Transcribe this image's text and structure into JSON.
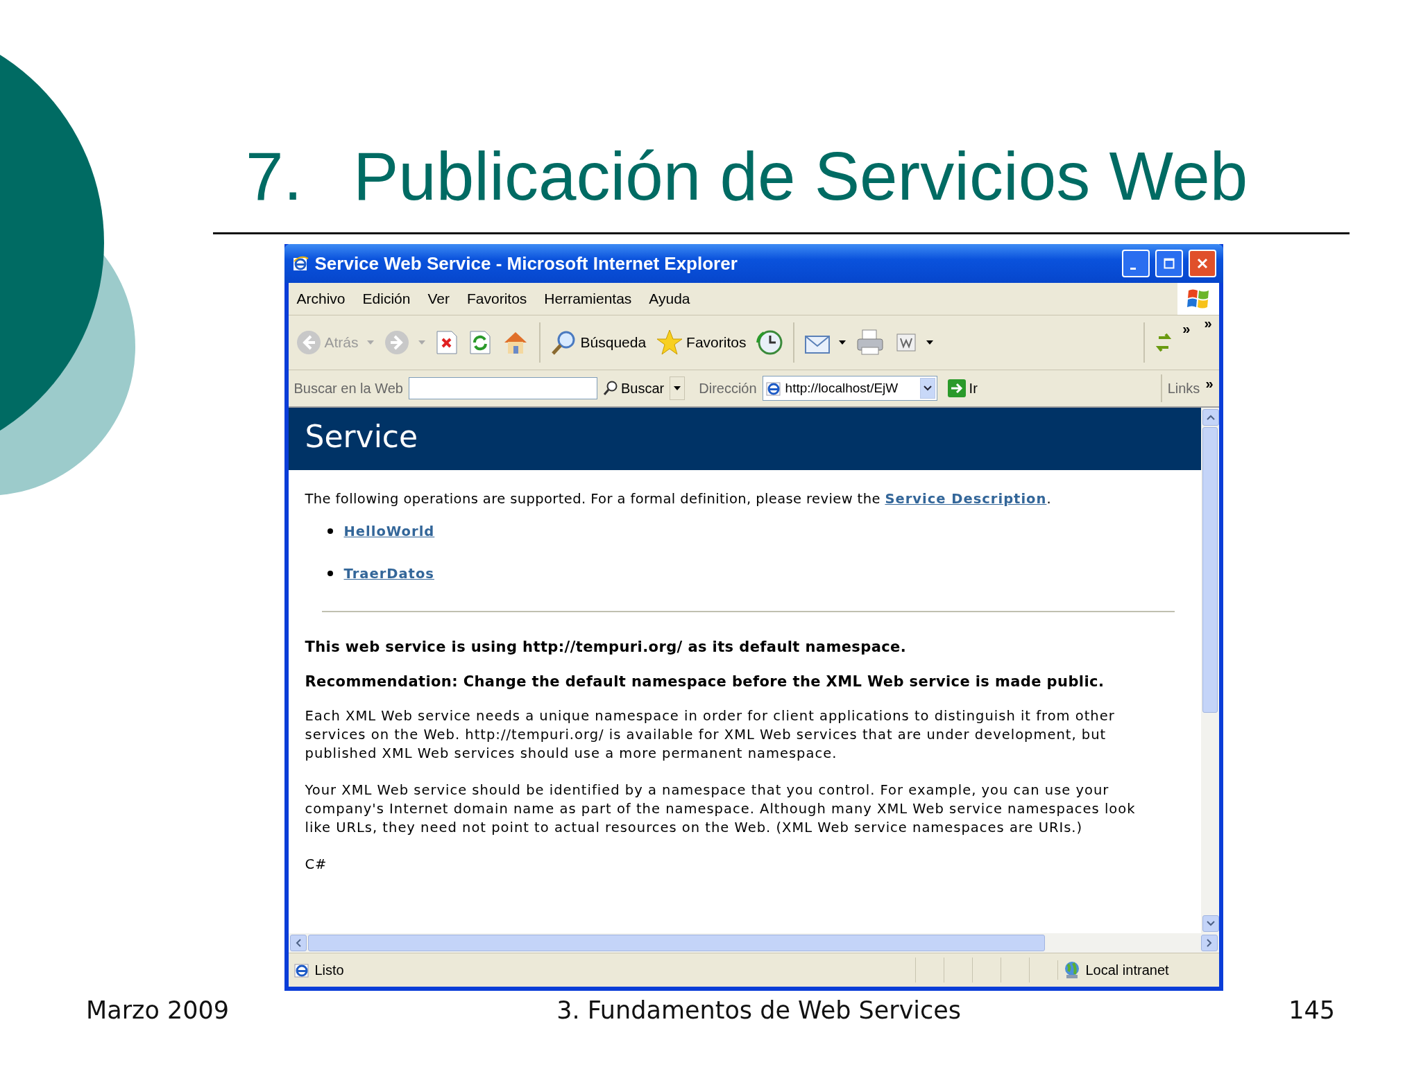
{
  "slide": {
    "number": "7.",
    "title": "Publicación de Servicios Web"
  },
  "window": {
    "title": "Service Web Service - Microsoft Internet Explorer"
  },
  "menu": [
    "Archivo",
    "Edición",
    "Ver",
    "Favoritos",
    "Herramientas",
    "Ayuda"
  ],
  "toolbar": {
    "back": {
      "label": "Atrás",
      "disabled": true
    },
    "search": "Búsqueda",
    "favorites": "Favoritos",
    "more": "»",
    "more_right": "»"
  },
  "search_bar": {
    "label": "Buscar en la Web",
    "button": "Buscar"
  },
  "address": {
    "label": "Dirección",
    "value": "http://localhost/EjW",
    "go": "Ir",
    "links": "Links",
    "more": "»"
  },
  "page": {
    "heading": "Service",
    "intro": "The following operations are supported. For a formal definition, please review the ",
    "intro_link": "Service Description",
    "intro_end": ".",
    "operations": [
      "HelloWorld",
      "TraerDatos"
    ],
    "notice": "This web service is using http://tempuri.org/ as its default namespace.",
    "recommendation": "Recommendation: Change the default namespace before the XML Web service is made public.",
    "paragraphs": [
      "Each XML Web service needs a unique namespace in order for client applications to distinguish it from other services on the Web. http://tempuri.org/ is available for XML Web services that are under development, but published XML Web services should use a more permanent namespace.",
      "Your XML Web service should be identified by a namespace that you control. For example, you can use your company's Internet domain name as part of the namespace. Although many XML Web service namespaces look like URLs, they need not point to actual resources on the Web. (XML Web service namespaces are URIs.)"
    ],
    "language": "C#"
  },
  "status_bar": {
    "text": "Listo",
    "zone": "Local intranet"
  },
  "footer": {
    "date": "Marzo 2009",
    "topic": "3. Fundamentos de Web Services",
    "page": "145"
  }
}
